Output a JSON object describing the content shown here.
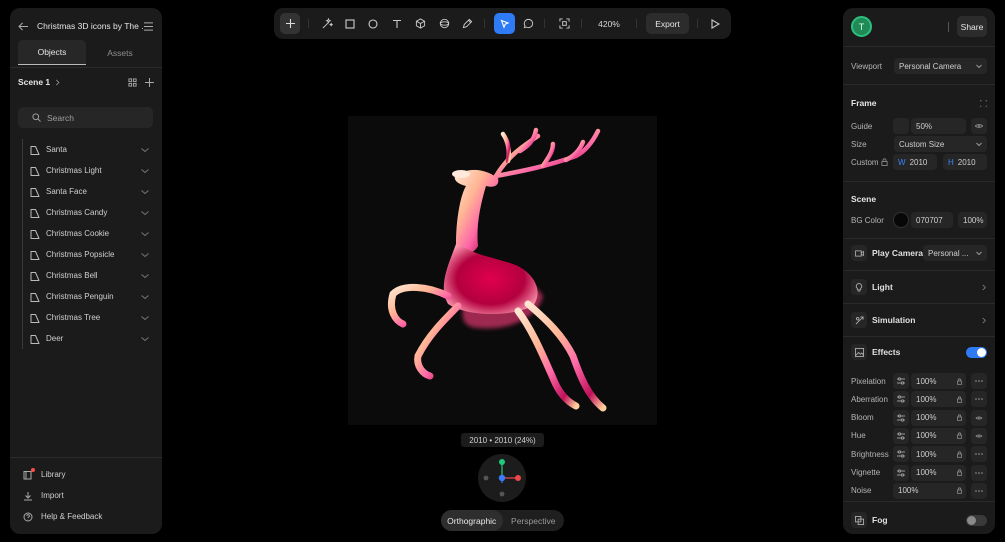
{
  "left_panel": {
    "project_title": "Christmas 3D icons by The ...",
    "tabs": [
      "Objects",
      "Assets"
    ],
    "scene_label": "Scene 1",
    "search_placeholder": "Search",
    "objects": [
      "Santa",
      "Christmas Light",
      "Santa Face",
      "Christmas Candy",
      "Christmas Cookie",
      "Christmas Popsicle",
      "Christmas Bell",
      "Christmas Penguin",
      "Christmas Tree",
      "Deer"
    ],
    "footer": [
      {
        "label": "Library",
        "icon": "library-icon"
      },
      {
        "label": "Import",
        "icon": "import-icon"
      },
      {
        "label": "Help & Feedback",
        "icon": "help-icon"
      }
    ]
  },
  "toolbar": {
    "zoom": "420%",
    "export_label": "Export",
    "tools": [
      "add-icon",
      "magic-icon",
      "rectangle-icon",
      "ellipse-icon",
      "text-icon",
      "cube-icon",
      "sphere-icon",
      "pen-icon",
      "select-icon",
      "comment-icon",
      "frame-icon",
      "play-icon"
    ],
    "accent": "#2f7bf5"
  },
  "canvas": {
    "dimensions_label": "2010 • 2010 (24%)",
    "view_modes": [
      "Orthographic",
      "Perspective"
    ],
    "active_view": "Orthographic"
  },
  "right_panel": {
    "avatar_letter": "T",
    "share_label": "Share",
    "viewport_label": "Viewport",
    "viewport_value": "Personal Camera",
    "frame": {
      "title": "Frame",
      "guide_label": "Guide",
      "guide_value": "50%",
      "size_label": "Size",
      "size_value": "Custom Size",
      "custom_label": "Custom",
      "w_label": "W",
      "w_value": "2010",
      "h_label": "H",
      "h_value": "2010"
    },
    "scene": {
      "title": "Scene",
      "bg_label": "BG Color",
      "bg_hex": "070707",
      "bg_opacity": "100%",
      "bg_color": "#070707"
    },
    "play_camera": {
      "label": "Play Camera",
      "value": "Personal ..."
    },
    "light_label": "Light",
    "simulation_label": "Simulation",
    "effects": {
      "label": "Effects",
      "enabled": true,
      "items": [
        {
          "label": "Pixelation",
          "value": "100%"
        },
        {
          "label": "Aberration",
          "value": "100%"
        },
        {
          "label": "Bloom",
          "value": "100%"
        },
        {
          "label": "Hue",
          "value": "100%"
        },
        {
          "label": "Brightness",
          "value": "100%"
        },
        {
          "label": "Vignette",
          "value": "100%"
        },
        {
          "label": "Noise",
          "value": "100%"
        }
      ]
    },
    "fog": {
      "label": "Fog",
      "enabled": false
    }
  }
}
